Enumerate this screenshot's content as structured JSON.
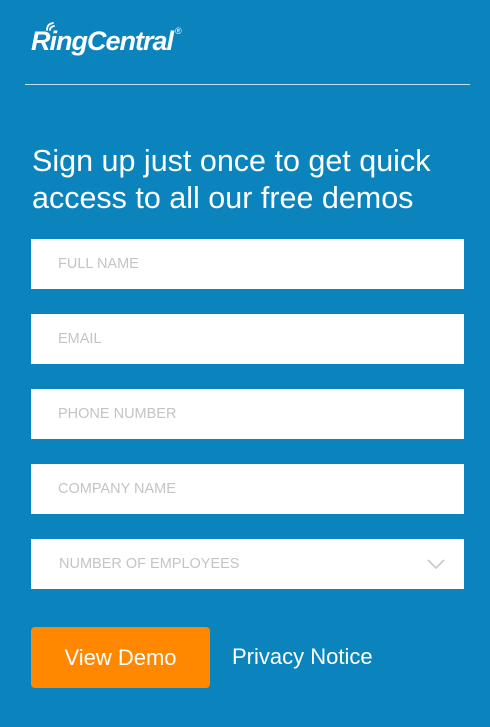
{
  "brand": {
    "logo_text": "RingCentral",
    "registered_mark": "®"
  },
  "headline": "Sign up just once to get quick access to all our free demos",
  "form": {
    "full_name": {
      "placeholder": "FULL NAME",
      "value": ""
    },
    "email": {
      "placeholder": "EMAIL",
      "value": ""
    },
    "phone": {
      "placeholder": "PHONE NUMBER",
      "value": ""
    },
    "company": {
      "placeholder": "COMPANY NAME",
      "value": ""
    },
    "employees": {
      "label": "NUMBER OF EMPLOYEES",
      "icon": "chevron-down-icon"
    }
  },
  "actions": {
    "submit_label": "View Demo",
    "privacy_label": "Privacy Notice"
  },
  "colors": {
    "background": "#0b84be",
    "button": "#ff8800",
    "text": "#ffffff",
    "placeholder": "#c4c4c4"
  }
}
